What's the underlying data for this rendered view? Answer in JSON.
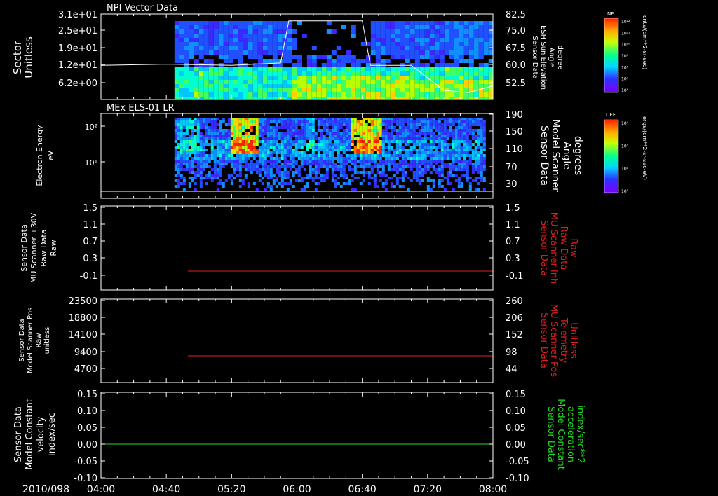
{
  "date_label": "2010/098",
  "time_ticks": [
    "04:00",
    "04:40",
    "05:20",
    "06:00",
    "06:40",
    "07:20",
    "08:00"
  ],
  "chart_data": [
    {
      "type": "heatmap",
      "title": "NPI Vector Data",
      "ylabel_left": [
        "Sector",
        "Unitless"
      ],
      "yticks_left": [
        "3.1e+01",
        "2.5e+01",
        "1.9e+01",
        "1.2e+01",
        "6.2e+00"
      ],
      "ylabel_right": [
        "Sensor Data",
        "ESH Sun Elevation",
        "Angle",
        "degree"
      ],
      "yticks_right": [
        "82.5",
        "75.0",
        "67.5",
        "60.0",
        "52.5"
      ],
      "ylim_right": [
        45,
        82.5
      ],
      "colorbar": {
        "label": "NF",
        "unit": "cnts/(cm**2-sr-sec)",
        "ticks": [
          "10¹²",
          "10¹¹",
          "10¹⁰",
          "10⁹",
          "10⁸",
          "10⁷",
          "10⁶"
        ]
      },
      "line_series": {
        "name": "ESH Sun Elevation Angle",
        "x": [
          "04:00",
          "04:40",
          "05:20",
          "05:50",
          "05:55",
          "06:40",
          "06:45",
          "07:10",
          "07:30",
          "07:45",
          "08:00"
        ],
        "y": [
          60.0,
          60.5,
          60.0,
          61.0,
          79.5,
          79.5,
          60.0,
          60.0,
          49.0,
          48.0,
          51.0
        ]
      }
    },
    {
      "type": "heatmap",
      "title": "MEx ELS-01 LR",
      "ylabel_left": [
        "Electron Energy",
        "eV"
      ],
      "yticks_left": [
        "10²",
        "10¹"
      ],
      "ylabel_right": [
        "Sensor Data",
        "Model Scanner",
        "Angle",
        "degrees"
      ],
      "yticks_right": [
        "190",
        "150",
        "110",
        "70",
        "30"
      ],
      "ylim_right": [
        0,
        190
      ],
      "colorbar": {
        "label": "DEF",
        "unit": "ergs/(cm**2-sr-sec-eV)",
        "ticks": [
          "10⁴",
          "10³",
          "10²",
          "10¹"
        ]
      },
      "line_series": {
        "name": "Model Scanner Angle",
        "x": [
          "04:00",
          "08:00"
        ],
        "y": [
          5,
          5
        ]
      }
    },
    {
      "type": "line",
      "ylabel_left": [
        "Sensor Data",
        "MU Scanner +30V",
        "Raw Data",
        "Raw"
      ],
      "yticks_left": [
        "1.5",
        "1.1",
        "0.7",
        "0.3",
        "-0.1"
      ],
      "ylabel_right": [
        "Sensor Data",
        "MU Scanner Inh",
        "Raw Data",
        "Raw"
      ],
      "yticks_right": [
        "1.5",
        "1.1",
        "0.7",
        "0.3",
        "-0.1"
      ],
      "ylim": [
        -0.5,
        1.5
      ],
      "series": [
        {
          "name": "MU Scanner Inh",
          "color": "#e02020",
          "x": [
            "04:45",
            "08:00"
          ],
          "y": [
            0,
            0
          ]
        }
      ]
    },
    {
      "type": "line",
      "ylabel_left": [
        "Sensor Data",
        "Model Scanner Pos",
        "Raw",
        "unitless"
      ],
      "yticks_left": [
        "23500",
        "18800",
        "14100",
        "9400",
        "4700"
      ],
      "ylabel_right": [
        "Sensor Data",
        "MU Scanner Pos",
        "Telemetry",
        "Unitless"
      ],
      "yticks_right": [
        "260",
        "206",
        "152",
        "98",
        "44"
      ],
      "ylim_right": [
        -10,
        260
      ],
      "series": [
        {
          "name": "MU Scanner Pos",
          "color": "#e02020",
          "x": [
            "04:45",
            "08:00"
          ],
          "y": [
            80,
            80
          ]
        }
      ]
    },
    {
      "type": "line",
      "ylabel_left": [
        "Sensor Data",
        "Model Constant",
        "velocity",
        "index/sec"
      ],
      "yticks_left": [
        "0.15",
        "0.10",
        "0.05",
        "0.00",
        "-0.05",
        "-0.10"
      ],
      "ylabel_right": [
        "Sensor Data",
        "Model Constant",
        "acceleration",
        "index/sec**2"
      ],
      "yticks_right": [
        "0.15",
        "0.10",
        "0.05",
        "0.00",
        "-0.05",
        "-0.10"
      ],
      "ylim": [
        -0.1,
        0.15
      ],
      "series": [
        {
          "name": "Model Constant acceleration",
          "color": "#22dd22",
          "x": [
            "04:00",
            "08:00"
          ],
          "y": [
            0.0,
            0.0
          ]
        }
      ]
    }
  ],
  "colors": {
    "axis": "#ffffff",
    "red_label": "#e02020",
    "green_label": "#22dd22"
  }
}
